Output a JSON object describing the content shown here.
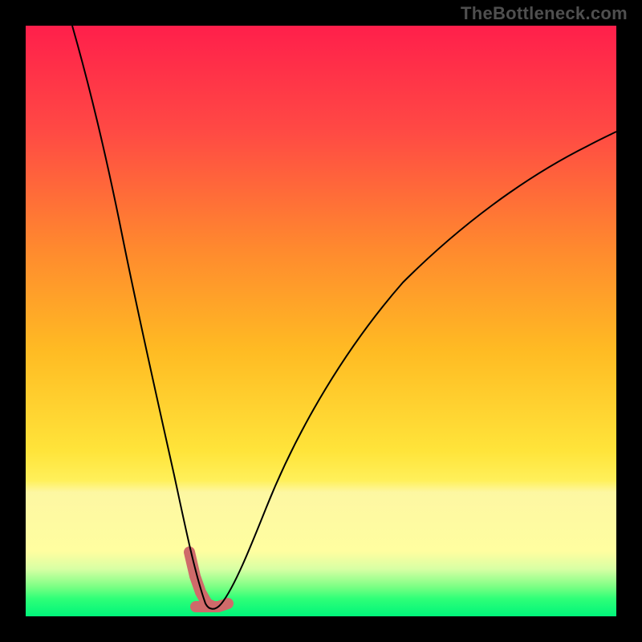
{
  "watermark": "TheBottleneck.com",
  "chart_data": {
    "type": "line",
    "title": "",
    "xlabel": "",
    "ylabel": "",
    "xlim": [
      0,
      100
    ],
    "ylim": [
      0,
      100
    ],
    "grid": false,
    "series": [
      {
        "name": "bottleneck-curve",
        "x": [
          8,
          10,
          12,
          14,
          16,
          18,
          20,
          22,
          24,
          26,
          28,
          29,
          30,
          31,
          32,
          33,
          34,
          36,
          38,
          40,
          44,
          48,
          54,
          60,
          66,
          72,
          78,
          84,
          90,
          96,
          100
        ],
        "values": [
          100,
          92,
          83,
          73,
          63,
          54,
          45,
          37,
          29,
          22,
          14,
          8,
          4,
          2,
          1,
          1,
          2,
          4,
          8,
          13,
          22,
          30,
          40,
          48,
          55,
          61,
          66,
          71,
          76,
          80,
          83
        ]
      }
    ],
    "highlight": {
      "region": "valley-bottom",
      "x_range": [
        27,
        34
      ],
      "y_range": [
        1,
        12
      ]
    },
    "colors": {
      "curve": "#000000",
      "highlight_stroke": "#cf6a6a",
      "gradient_top": "#ff1f4b",
      "gradient_bottom": "#00f57a"
    }
  }
}
